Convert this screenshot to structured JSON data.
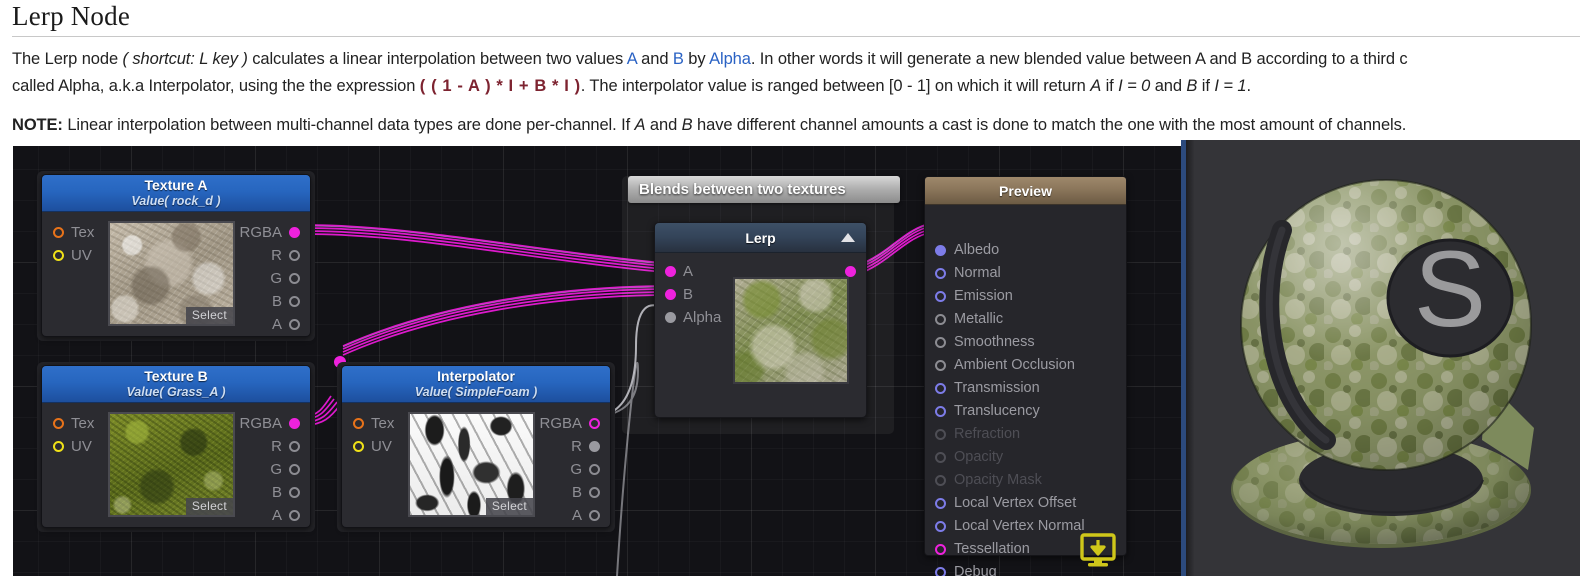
{
  "doc": {
    "title": "Lerp Node",
    "paragraph1": {
      "s1": "The Lerp node ",
      "shortcut": "( shortcut: L key )",
      "s2": " calculates a linear interpolation between two values ",
      "a1": "A",
      "s3": " and ",
      "b1": "B",
      "s4": " by ",
      "alpha1": "Alpha",
      "s5": ". In other words it will generate a new blended value between A and B according to a third c",
      "l2s1": "called Alpha, a.k.a Interpolator, using the the expression ",
      "expr": "( ( 1 - A ) * I + B * I )",
      "l2s2": ". The interpolator value is ranged between [0 - 1] on which it will return ",
      "l2a": "A",
      "l2s3": " if ",
      "l2i0": "I = 0",
      "l2s4": " and ",
      "l2b": "B",
      "l2s5": " if ",
      "l2i1": "I = 1",
      "l2s6": "."
    },
    "paragraph2": {
      "note": "NOTE:",
      "s1": " Linear interpolation between multi-channel data types are done per-channel. If ",
      "a": "A",
      "s2": " and ",
      "b": "B",
      "s3": " have different channel amounts a cast is done to match the one with the most amount of channels."
    }
  },
  "nodes": {
    "texture_a": {
      "title": "Texture A",
      "subtitle": "Value( rock_d )",
      "inputs": [
        {
          "label": "Tex",
          "dot": "ring-orange"
        },
        {
          "label": "UV",
          "dot": "ring-yellow"
        }
      ],
      "outputs": [
        {
          "label": "RGBA",
          "dot": "fill-magenta"
        },
        {
          "label": "R",
          "dot": "ring-gray"
        },
        {
          "label": "G",
          "dot": "ring-gray"
        },
        {
          "label": "B",
          "dot": "ring-gray"
        },
        {
          "label": "A",
          "dot": "ring-gray"
        }
      ],
      "thumb_button": "Select"
    },
    "texture_b": {
      "title": "Texture B",
      "subtitle": "Value( Grass_A )",
      "inputs": [
        {
          "label": "Tex",
          "dot": "ring-orange"
        },
        {
          "label": "UV",
          "dot": "ring-yellow"
        }
      ],
      "outputs": [
        {
          "label": "RGBA",
          "dot": "fill-magenta"
        },
        {
          "label": "R",
          "dot": "ring-gray"
        },
        {
          "label": "G",
          "dot": "ring-gray"
        },
        {
          "label": "B",
          "dot": "ring-gray"
        },
        {
          "label": "A",
          "dot": "ring-gray"
        }
      ],
      "thumb_button": "Select"
    },
    "interpolator": {
      "title": "Interpolator",
      "subtitle": "Value( SimpleFoam )",
      "inputs": [
        {
          "label": "Tex",
          "dot": "ring-orange"
        },
        {
          "label": "UV",
          "dot": "ring-yellow"
        }
      ],
      "outputs": [
        {
          "label": "RGBA",
          "dot": "ring-magenta"
        },
        {
          "label": "R",
          "dot": "fill-gray"
        },
        {
          "label": "G",
          "dot": "ring-gray"
        },
        {
          "label": "B",
          "dot": "ring-gray"
        },
        {
          "label": "A",
          "dot": "ring-gray"
        }
      ],
      "thumb_button": "Select"
    },
    "comment": {
      "title": "Blends between two textures"
    },
    "lerp": {
      "title": "Lerp",
      "collapse_icon": "triangle-up-icon",
      "inputs": [
        {
          "label": "A",
          "dot": "fill-magenta"
        },
        {
          "label": "B",
          "dot": "fill-magenta"
        },
        {
          "label": "Alpha",
          "dot": "fill-gray"
        }
      ],
      "outputs": [
        {
          "label": "",
          "dot": "fill-magenta"
        }
      ]
    },
    "preview": {
      "title": "Preview",
      "compile_icon": "compile-download-icon",
      "slots": [
        {
          "label": "Albedo",
          "dot": "fill-blue",
          "dim": false
        },
        {
          "label": "Normal",
          "dot": "ring-blue",
          "dim": false
        },
        {
          "label": "Emission",
          "dot": "ring-blue",
          "dim": false
        },
        {
          "label": "Metallic",
          "dot": "ring-gray",
          "dim": false
        },
        {
          "label": "Smoothness",
          "dot": "ring-gray",
          "dim": false
        },
        {
          "label": "Ambient Occlusion",
          "dot": "ring-gray",
          "dim": false
        },
        {
          "label": "Transmission",
          "dot": "ring-blue",
          "dim": false
        },
        {
          "label": "Translucency",
          "dot": "ring-blue",
          "dim": false
        },
        {
          "label": "Refraction",
          "dot": "ring-dim",
          "dim": true
        },
        {
          "label": "Opacity",
          "dot": "ring-dim",
          "dim": true
        },
        {
          "label": "Opacity Mask",
          "dot": "ring-dim",
          "dim": true
        },
        {
          "label": "Local Vertex Offset",
          "dot": "ring-blue",
          "dim": false
        },
        {
          "label": "Local Vertex Normal",
          "dot": "ring-blue",
          "dim": false
        },
        {
          "label": "Tessellation",
          "dot": "ring-magenta",
          "dim": false
        },
        {
          "label": "Debug",
          "dot": "ring-blue",
          "dim": false
        }
      ]
    }
  },
  "viewport": {
    "logo_letter": "S"
  },
  "colors": {
    "wire_rgba": "#e81ad6",
    "wire_alpha": "#c9c9cf",
    "port_orange": "#e8731a",
    "port_yellow": "#f0e118",
    "port_blue": "#7d7ce8",
    "port_magenta": "#ee22dd",
    "node_header_blue": "#2766bf",
    "preview_header": "#8b765b",
    "divider_blue": "#2c4a7d",
    "link_blue": "#2a62c4",
    "expression_red": "#7d2330",
    "compile_yellow": "#d4cc16"
  }
}
